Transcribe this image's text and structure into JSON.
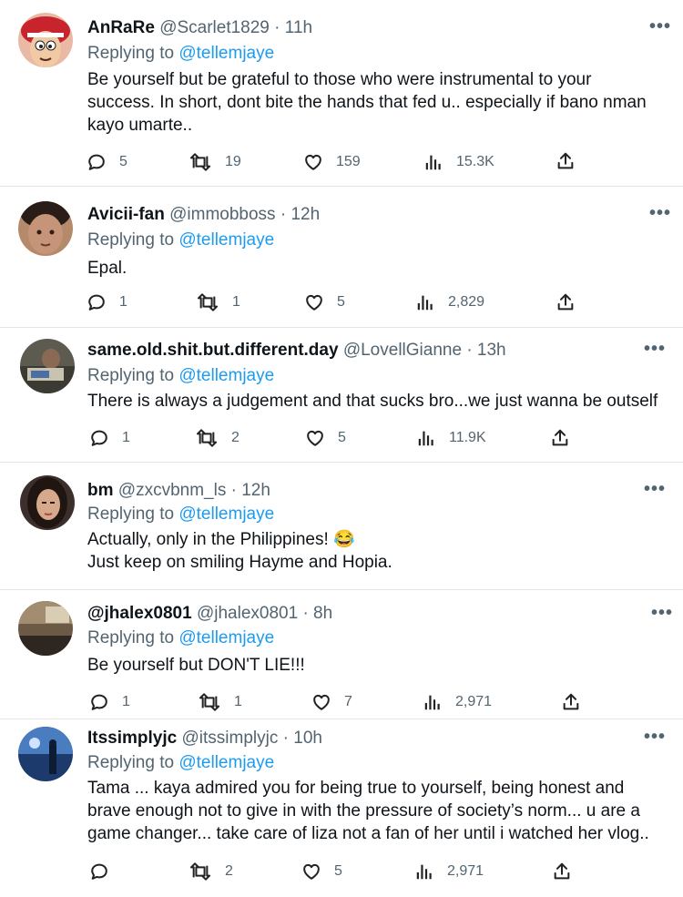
{
  "tweets": [
    {
      "name": "AnRaRe",
      "handle": "@Scarlet1829",
      "time": "11h",
      "replying_prefix": "Replying to",
      "replying_to": "@tellemjaye",
      "text": "Be yourself but be grateful to those who were instrumental to your\nsuccess. In short, dont bite the hands that fed u.. especially if bano nman\nkayo umarte..",
      "replies": "5",
      "retweets": "19",
      "likes": "159",
      "views": "15.3K",
      "avatar_icon": "cartoon-avatar"
    },
    {
      "name": "Avicii-fan",
      "handle": "@immobboss",
      "time": "12h",
      "replying_prefix": "Replying to",
      "replying_to": "@tellemjaye",
      "text": "Epal.",
      "replies": "1",
      "retweets": "1",
      "likes": "5",
      "views": "2,829",
      "avatar_icon": "photo-avatar"
    },
    {
      "name": "same.old.shit.but.different.day",
      "handle": "@LovellGianne",
      "time": "13h",
      "replying_prefix": "Replying to",
      "replying_to": "@tellemjaye",
      "text": "There is always a judgement and that sucks bro...we just wanna be outself",
      "replies": "1",
      "retweets": "2",
      "likes": "5",
      "views": "11.9K",
      "avatar_icon": "photo-avatar"
    },
    {
      "name": "bm",
      "handle": "@zxcvbnm_ls",
      "time": "12h",
      "replying_prefix": "Replying to",
      "replying_to": "@tellemjaye",
      "text": "Actually, only in the Philippines! 😂\n Just keep on smiling Hayme and Hopia.",
      "avatar_icon": "photo-avatar"
    },
    {
      "name": "@jhalex0801",
      "handle": "@jhalex0801",
      "time": "8h",
      "replying_prefix": "Replying to",
      "replying_to": "@tellemjaye",
      "text": "Be yourself but DON'T LIE!!!",
      "replies": "1",
      "retweets": "1",
      "likes": "7",
      "views": "2,971",
      "avatar_icon": "photo-avatar"
    },
    {
      "name": "Itssimplyjc",
      "handle": "@itssimplyjc",
      "time": "10h",
      "replying_prefix": "Replying to",
      "replying_to": "@tellemjaye",
      "text": "Tama ... kaya admired you for being true to yourself, being honest and\nbrave enough not to give in with the pressure of society’s norm... u are a\ngame changer... take care of liza not a fan of her until i watched her vlog..",
      "replies": "",
      "retweets": "2",
      "likes": "5",
      "views": "2,971",
      "avatar_icon": "photo-avatar"
    }
  ],
  "separator": "·",
  "more_glyph": "•••",
  "colors": {
    "link": "#1d9bf0",
    "muted": "#536471",
    "text": "#0f1419",
    "border": "#e3e6e8"
  }
}
